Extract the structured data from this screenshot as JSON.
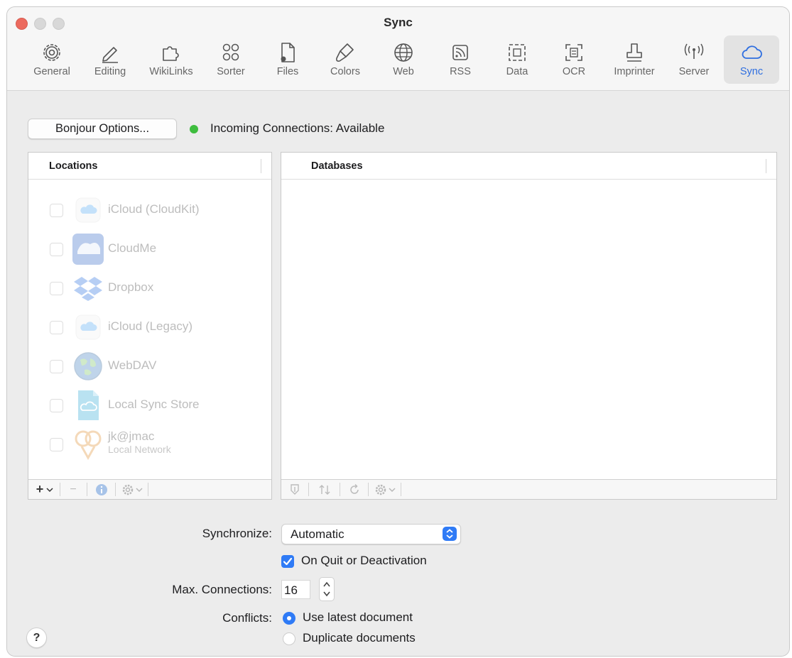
{
  "window": {
    "title": "Sync"
  },
  "toolbar": {
    "items": [
      {
        "label": "General",
        "icon": "gear-icon"
      },
      {
        "label": "Editing",
        "icon": "pencil-icon"
      },
      {
        "label": "WikiLinks",
        "icon": "puzzle-icon"
      },
      {
        "label": "Sorter",
        "icon": "circles-icon"
      },
      {
        "label": "Files",
        "icon": "file-gear-icon"
      },
      {
        "label": "Colors",
        "icon": "paintbrush-icon"
      },
      {
        "label": "Web",
        "icon": "globe-icon"
      },
      {
        "label": "RSS",
        "icon": "rss-icon"
      },
      {
        "label": "Data",
        "icon": "dashed-square-icon"
      },
      {
        "label": "OCR",
        "icon": "ocr-icon"
      },
      {
        "label": "Imprinter",
        "icon": "stamp-icon"
      },
      {
        "label": "Server",
        "icon": "antenna-icon"
      },
      {
        "label": "Sync",
        "icon": "cloud-icon"
      }
    ],
    "selected": "Sync",
    "accent_color": "#2f6fe0"
  },
  "bonjour": {
    "button_label": "Bonjour Options...",
    "status_text": "Incoming Connections: Available",
    "status_color": "#3ebd3e"
  },
  "locations": {
    "header": "Locations",
    "items": [
      {
        "name": "iCloud (CloudKit)",
        "icon": "icloud-icon",
        "checked": false
      },
      {
        "name": "CloudMe",
        "icon": "cloudme-icon",
        "checked": false
      },
      {
        "name": "Dropbox",
        "icon": "dropbox-icon",
        "checked": false
      },
      {
        "name": "iCloud (Legacy)",
        "icon": "icloud-icon",
        "checked": false
      },
      {
        "name": "WebDAV",
        "icon": "webdav-globe-icon",
        "checked": false
      },
      {
        "name": "Local Sync Store",
        "icon": "local-store-icon",
        "checked": false
      },
      {
        "name": "jk@jmac",
        "subtitle": "Local Network",
        "icon": "bonjour-icon",
        "checked": false
      }
    ],
    "footer": {
      "add": "+",
      "remove": "−"
    }
  },
  "databases": {
    "header": "Databases"
  },
  "form": {
    "synchronize_label": "Synchronize:",
    "synchronize_value": "Automatic",
    "quit_checkbox_label": "On Quit or Deactivation",
    "quit_checkbox_checked": true,
    "max_connections_label": "Max. Connections:",
    "max_connections_value": "16",
    "conflicts_label": "Conflicts:",
    "conflict_options": [
      {
        "label": "Use latest document",
        "selected": true
      },
      {
        "label": "Duplicate documents",
        "selected": false
      }
    ]
  },
  "help": {
    "label": "?"
  }
}
